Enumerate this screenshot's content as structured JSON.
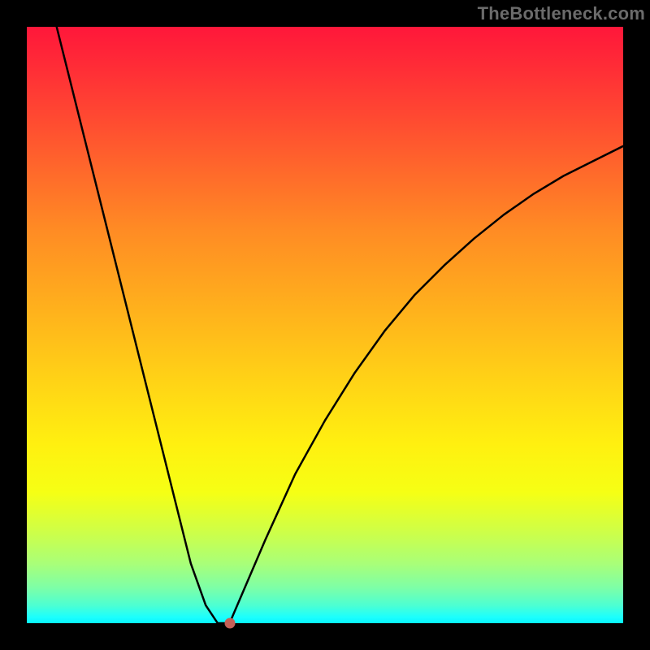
{
  "attribution": "TheBottleneck.com",
  "chart_data": {
    "type": "line",
    "title": "",
    "xlabel": "",
    "ylabel": "",
    "xlim": [
      0,
      100
    ],
    "ylim": [
      0,
      100
    ],
    "curve": {
      "description": "V-shaped bottleneck curve",
      "x": [
        5,
        10,
        15,
        20,
        25,
        27.5,
        30,
        32,
        34,
        40,
        45,
        50,
        55,
        60,
        65,
        70,
        75,
        80,
        85,
        90,
        95,
        100
      ],
      "y": [
        100,
        80,
        60,
        40,
        20,
        10,
        3,
        0,
        0,
        14,
        25,
        34,
        42,
        49,
        55,
        60,
        64.5,
        68.5,
        72,
        75,
        77.5,
        80
      ]
    },
    "marker": {
      "x": 34,
      "y": 0,
      "color": "#c46058"
    },
    "gradient_stops": [
      {
        "pos": 0,
        "color": "#ff173a"
      },
      {
        "pos": 70,
        "color": "#fff010"
      },
      {
        "pos": 100,
        "color": "#07f6ff"
      }
    ]
  }
}
